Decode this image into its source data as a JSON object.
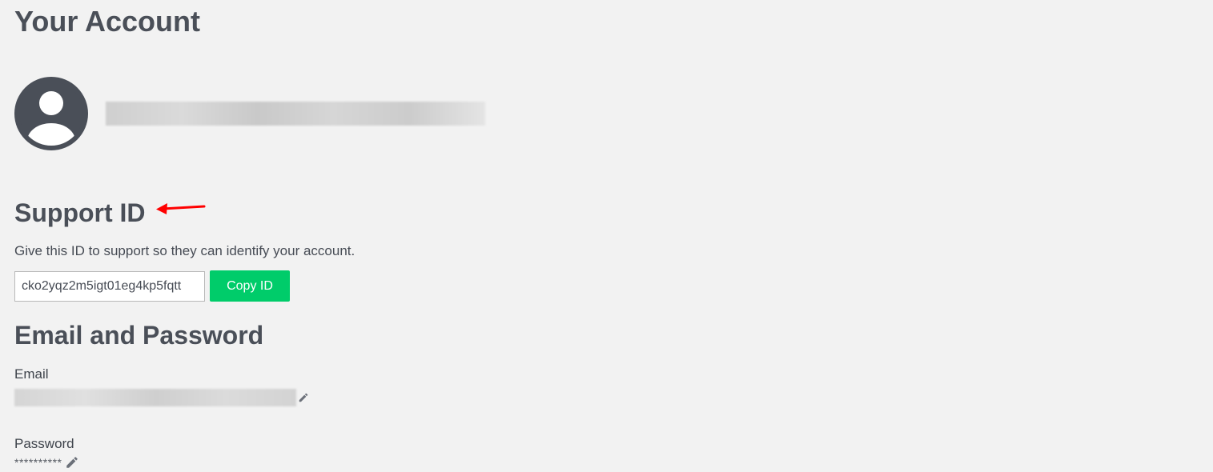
{
  "page": {
    "title": "Your Account"
  },
  "profile": {
    "avatar_icon": "user-circle-icon",
    "avatar_color": "#4a4f58"
  },
  "support": {
    "heading": "Support ID",
    "description": "Give this ID to support so they can identify your account.",
    "id_value": "cko2yqz2m5igt01eg4kp5fqtt",
    "copy_label": "Copy ID",
    "annotation_icon": "red-arrow-icon",
    "annotation_color": "#ff0000"
  },
  "credentials": {
    "heading": "Email and Password",
    "email_label": "Email",
    "password_label": "Password",
    "password_mask": "**********",
    "edit_icon": "pencil-icon"
  },
  "colors": {
    "background": "#f2f2f2",
    "text": "#474c55",
    "accent": "#00cc6a"
  }
}
